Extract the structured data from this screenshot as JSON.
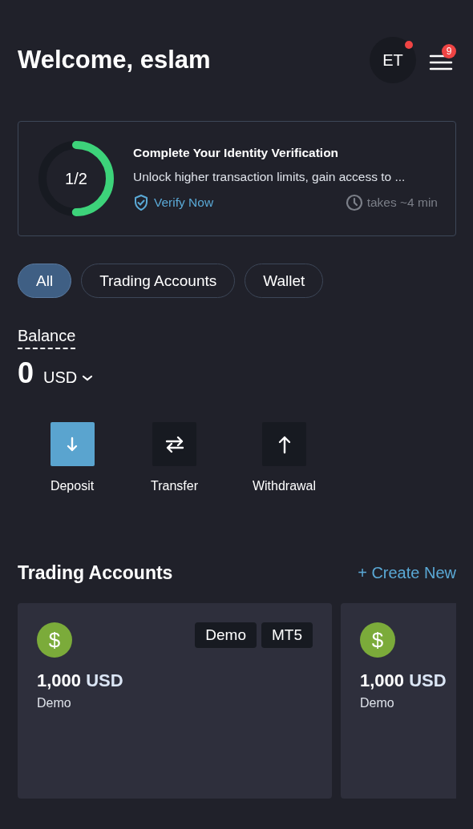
{
  "header": {
    "title": "Welcome, eslam",
    "avatar": {
      "initials": "ET",
      "notification": true
    },
    "menu": {
      "badge": "9"
    }
  },
  "verification": {
    "progress": {
      "label": "1/2",
      "level": 0.5
    },
    "title": "Complete Your Identity Verification",
    "description": "Unlock higher transaction limits, gain access to ...",
    "action": "Verify Now",
    "duration": "takes ~4 min"
  },
  "filters": [
    {
      "label": "All",
      "selected": true
    },
    {
      "label": "Trading Accounts",
      "selected": false
    },
    {
      "label": "Wallet",
      "selected": false
    }
  ],
  "balance": {
    "label": "Balance",
    "amount": "0",
    "currency": "USD"
  },
  "actions": [
    {
      "label": "Deposit",
      "kind": "down",
      "selected": true
    },
    {
      "label": "Transfer",
      "kind": "swap",
      "selected": false
    },
    {
      "label": "Withdrawal",
      "kind": "up",
      "selected": false
    }
  ],
  "trading_accounts": {
    "title": "Trading Accounts",
    "create": "+ Create New",
    "accounts": [
      {
        "icon": "$",
        "tags": [
          "Demo",
          "MT5"
        ],
        "amount": "1,000",
        "currency": "USD",
        "type": "Demo"
      },
      {
        "icon": "$",
        "amount": "1,000",
        "currency": "USD",
        "type": "Demo"
      }
    ]
  }
}
